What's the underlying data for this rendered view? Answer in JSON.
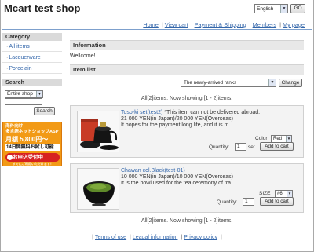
{
  "header": {
    "title": "Mcart test shop",
    "language": "English",
    "go_label": "GO",
    "nav": [
      "Home",
      "View cart",
      "Payment & Shipping",
      "Members",
      "My page"
    ]
  },
  "sidebar": {
    "category_title": "Category",
    "categories": [
      "All items",
      "Lacquerware",
      "Porcelain"
    ],
    "search_title": "Search",
    "search_scope": "Entire shop",
    "search_value": "",
    "search_button": "Search",
    "banner": {
      "line1": "海外向け",
      "line2": "多言語ネットショップASP",
      "price": "月額 5,800円〜",
      "trial": "14日間無料お試し可能",
      "cta": "お申込受付中",
      "sub": "すぐにご利用いただけます！"
    }
  },
  "main": {
    "info_title": "Information",
    "welcome": "Wellcome!",
    "list_title": "Item list",
    "sort_value": "The newly-arrived ranks",
    "change_label": "Change",
    "count_text": "All[2]items. Now showing [1 - 2]items.",
    "products": [
      {
        "name": "Toso-ki set(test2)",
        "note": "*This item can not be delivered abroad.",
        "price": "21 000 YEN(in Japan)/20 000 YEN(Overseas)",
        "desc": "It hopes for the payment long life, and it is m...",
        "option_label": "Color",
        "option_value": "Red",
        "quantity_label": "Quantity:",
        "quantity": "1",
        "unit": "set",
        "cart_label": "Add to cart"
      },
      {
        "name": "Chawan col.Black(test-01)",
        "note": "",
        "price": "10 000 YEN(in Japan)/10 000 YEN(Overseas)",
        "desc": "It is the bowl used for the tea ceremony of tra...",
        "option_label": "SIZE",
        "option_value": "#6",
        "quantity_label": "Quantity:",
        "quantity": "1",
        "unit": "",
        "cart_label": "Add to cart"
      }
    ]
  },
  "footer": {
    "nav": [
      "Terms of use",
      "Leagal information",
      "Privacy policy"
    ]
  },
  "colors": {
    "link": "#3366aa",
    "banner": "#f29a16",
    "banner_cta": "#d72121",
    "section_bar": "#e8e8e8"
  }
}
